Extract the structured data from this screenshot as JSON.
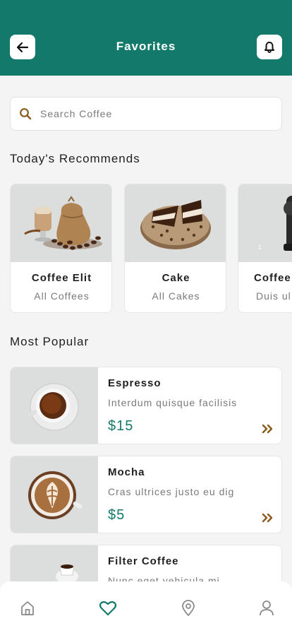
{
  "header": {
    "title": "Favorites",
    "back_icon": "arrow-left-icon",
    "notif_icon": "bell-icon",
    "bg_color": "#13796b"
  },
  "search": {
    "placeholder": "Search Coffee",
    "icon": "search-icon"
  },
  "recommends": {
    "title": "Today's Recommends",
    "items": [
      {
        "name": "Coffee Elit",
        "subtitle": "All Coffees"
      },
      {
        "name": "Cake",
        "subtitle": "All Cakes"
      },
      {
        "name": "Coffee",
        "subtitle": "Duis ul"
      }
    ]
  },
  "popular": {
    "title": "Most Popular",
    "items": [
      {
        "name": "Espresso",
        "desc": "Interdum quisque facilisis",
        "price": "$15"
      },
      {
        "name": "Mocha",
        "desc": "Cras ultrices justo eu dig",
        "price": "$5"
      },
      {
        "name": "Filter Coffee",
        "desc": "Nunc eget vehicula mi",
        "price": ""
      }
    ]
  },
  "tabbar": {
    "items": [
      {
        "icon": "home-icon",
        "active": false
      },
      {
        "icon": "heart-icon",
        "active": true
      },
      {
        "icon": "location-pin-icon",
        "active": false
      },
      {
        "icon": "profile-icon",
        "active": false
      }
    ]
  },
  "colors": {
    "accent": "#13796b",
    "chevron": "#8a5a1c",
    "muted": "#7a7a7a"
  }
}
